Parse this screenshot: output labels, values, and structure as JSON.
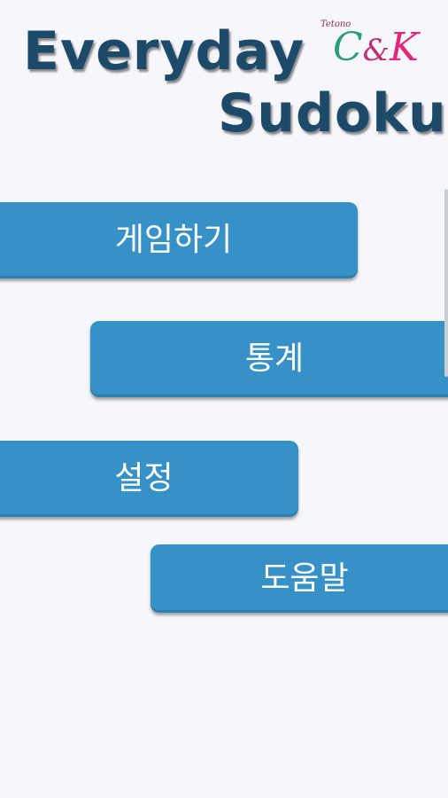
{
  "app": {
    "title_line1": "Everyday",
    "title_line2": "Sudoku",
    "brand": {
      "subtitle": "Tetono",
      "c": "C",
      "amp": "&",
      "k": "K"
    }
  },
  "menu": {
    "play": "게임하기",
    "stats": "통계",
    "settings": "설정",
    "help": "도움말"
  },
  "colors": {
    "background": "#f5f7fc",
    "button": "#3691c6",
    "title": "#1e4a6a",
    "brand_c": "#2b9e77",
    "brand_k": "#e2267a"
  }
}
